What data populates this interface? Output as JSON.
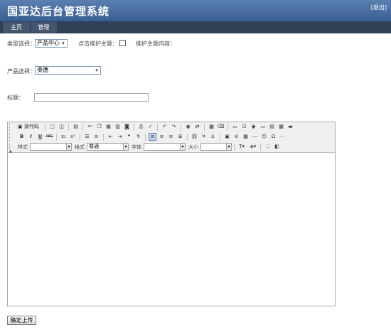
{
  "header": {
    "title": "国亚达后台管理系统",
    "logout_open": "[",
    "logout_label": "退出",
    "logout_close": "]"
  },
  "nav": {
    "tabs": [
      {
        "label": "主页"
      },
      {
        "label": "管理"
      }
    ]
  },
  "form": {
    "type_label": "类型选择：",
    "type_value": "产品中心",
    "maintain_label": "点击维护主题：",
    "maintain_content_label": "维护主题内容：",
    "product_label": "产品选择：",
    "product_value": "贵德",
    "title_label": "标题：",
    "title_value": "",
    "submit_label": "确定上传"
  },
  "editor": {
    "source_label": "源代码",
    "style_label": "样式",
    "format_label": "格式",
    "format_value": "普通",
    "font_label": "字体",
    "size_label": "大小",
    "bold": "B",
    "italic": "I",
    "underline": "U",
    "strike": "ABC",
    "subscript": "x₂",
    "superscript": "x²"
  }
}
